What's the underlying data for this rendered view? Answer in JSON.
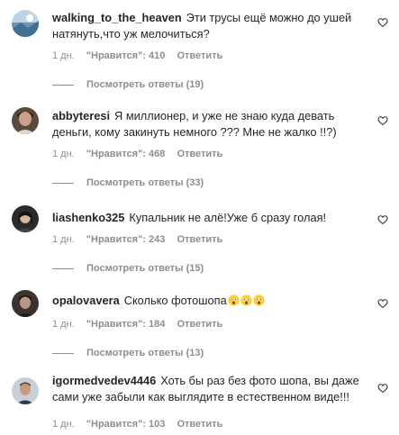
{
  "comments": [
    {
      "username": "walking_to_the_heaven",
      "text": "Эти трусы ещё можно до ушей натянуть,что уж мелочиться?",
      "time": "1 дн.",
      "likes": "\"Нравится\": 410",
      "reply": "Ответить",
      "view_replies": "Посмотреть ответы (19)"
    },
    {
      "username": "abbyteresi",
      "text": "Я миллионер, и уже не знаю куда девать деньги, кому закинуть немного ??? Мне не жалко !!?)",
      "time": "1 дн.",
      "likes": "\"Нравится\": 468",
      "reply": "Ответить",
      "view_replies": "Посмотреть ответы (33)"
    },
    {
      "username": "liashenko325",
      "text": "Купальник не алё!Уже б сразу голая!",
      "time": "1 дн.",
      "likes": "\"Нравится\": 243",
      "reply": "Ответить",
      "view_replies": "Посмотреть ответы (15)"
    },
    {
      "username": "opalovavera",
      "text": "Сколько фотошопа",
      "time": "1 дн.",
      "likes": "\"Нравится\": 184",
      "reply": "Ответить",
      "view_replies": "Посмотреть ответы (13)"
    },
    {
      "username": "igormedvedev4446",
      "text": "Хоть бы раз без фото шопа, вы даже сами уже забыли как выглядите в естественном виде!!!",
      "time": "1 дн.",
      "likes": "\"Нравится\": 103",
      "reply": "Ответить"
    }
  ]
}
